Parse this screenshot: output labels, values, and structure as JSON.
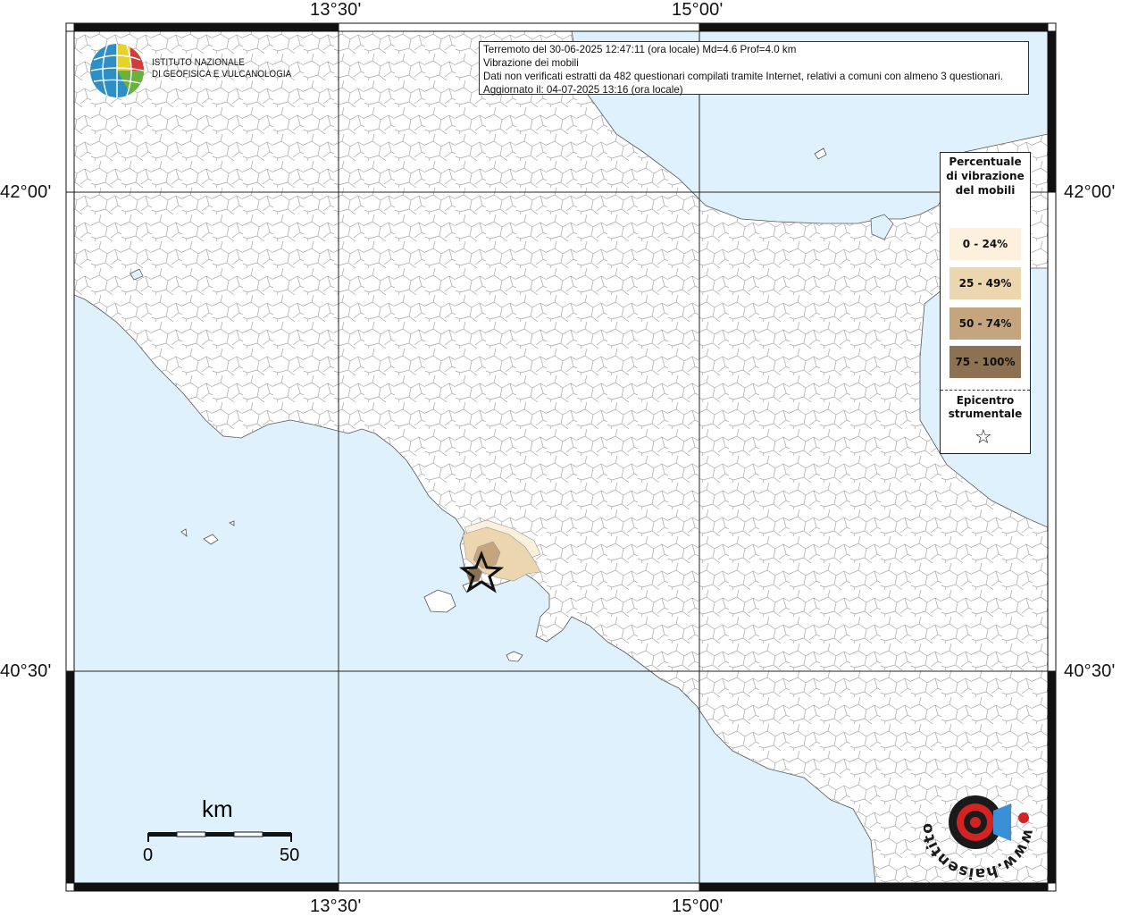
{
  "frame": {
    "lon_labels": [
      "13°30'",
      "15°00'"
    ],
    "lat_labels": [
      "42°00'",
      "40°30'"
    ]
  },
  "logo": {
    "line1": "ISTITUTO NAZIONALE",
    "line2": "DI GEOFISICA E VULCANOLOGIA"
  },
  "info": {
    "line1": "Terremoto del 30-06-2025 12:47:11 (ora locale) Md=4.6 Prof=4.0 km",
    "line2": "Vibrazione dei mobili",
    "line3": "Dati non verificati estratti da 482 questionari compilati tramite Internet, relativi a comuni con almeno 3 questionari.",
    "line4": "Aggiornato il: 04-07-2025 13:16 (ora locale)"
  },
  "legend": {
    "title": "Percentuale di vibrazione del mobili",
    "items": [
      {
        "label": "0 - 24%",
        "color": "#fdf0dd"
      },
      {
        "label": "25 - 49%",
        "color": "#ecd6b0"
      },
      {
        "label": "50 - 74%",
        "color": "#c4a57e"
      },
      {
        "label": "75 - 100%",
        "color": "#8c7252"
      }
    ],
    "epicenter_label": "Epicentro strumentale",
    "epicenter_symbol": "☆"
  },
  "scale": {
    "title": "km",
    "min": "0",
    "max": "50"
  },
  "watermark": {
    "text": "www.haisentitoilterremoto.it"
  },
  "colors": {
    "sea": "#dff1fc",
    "land": "#ffffff",
    "borders": "#888888"
  }
}
